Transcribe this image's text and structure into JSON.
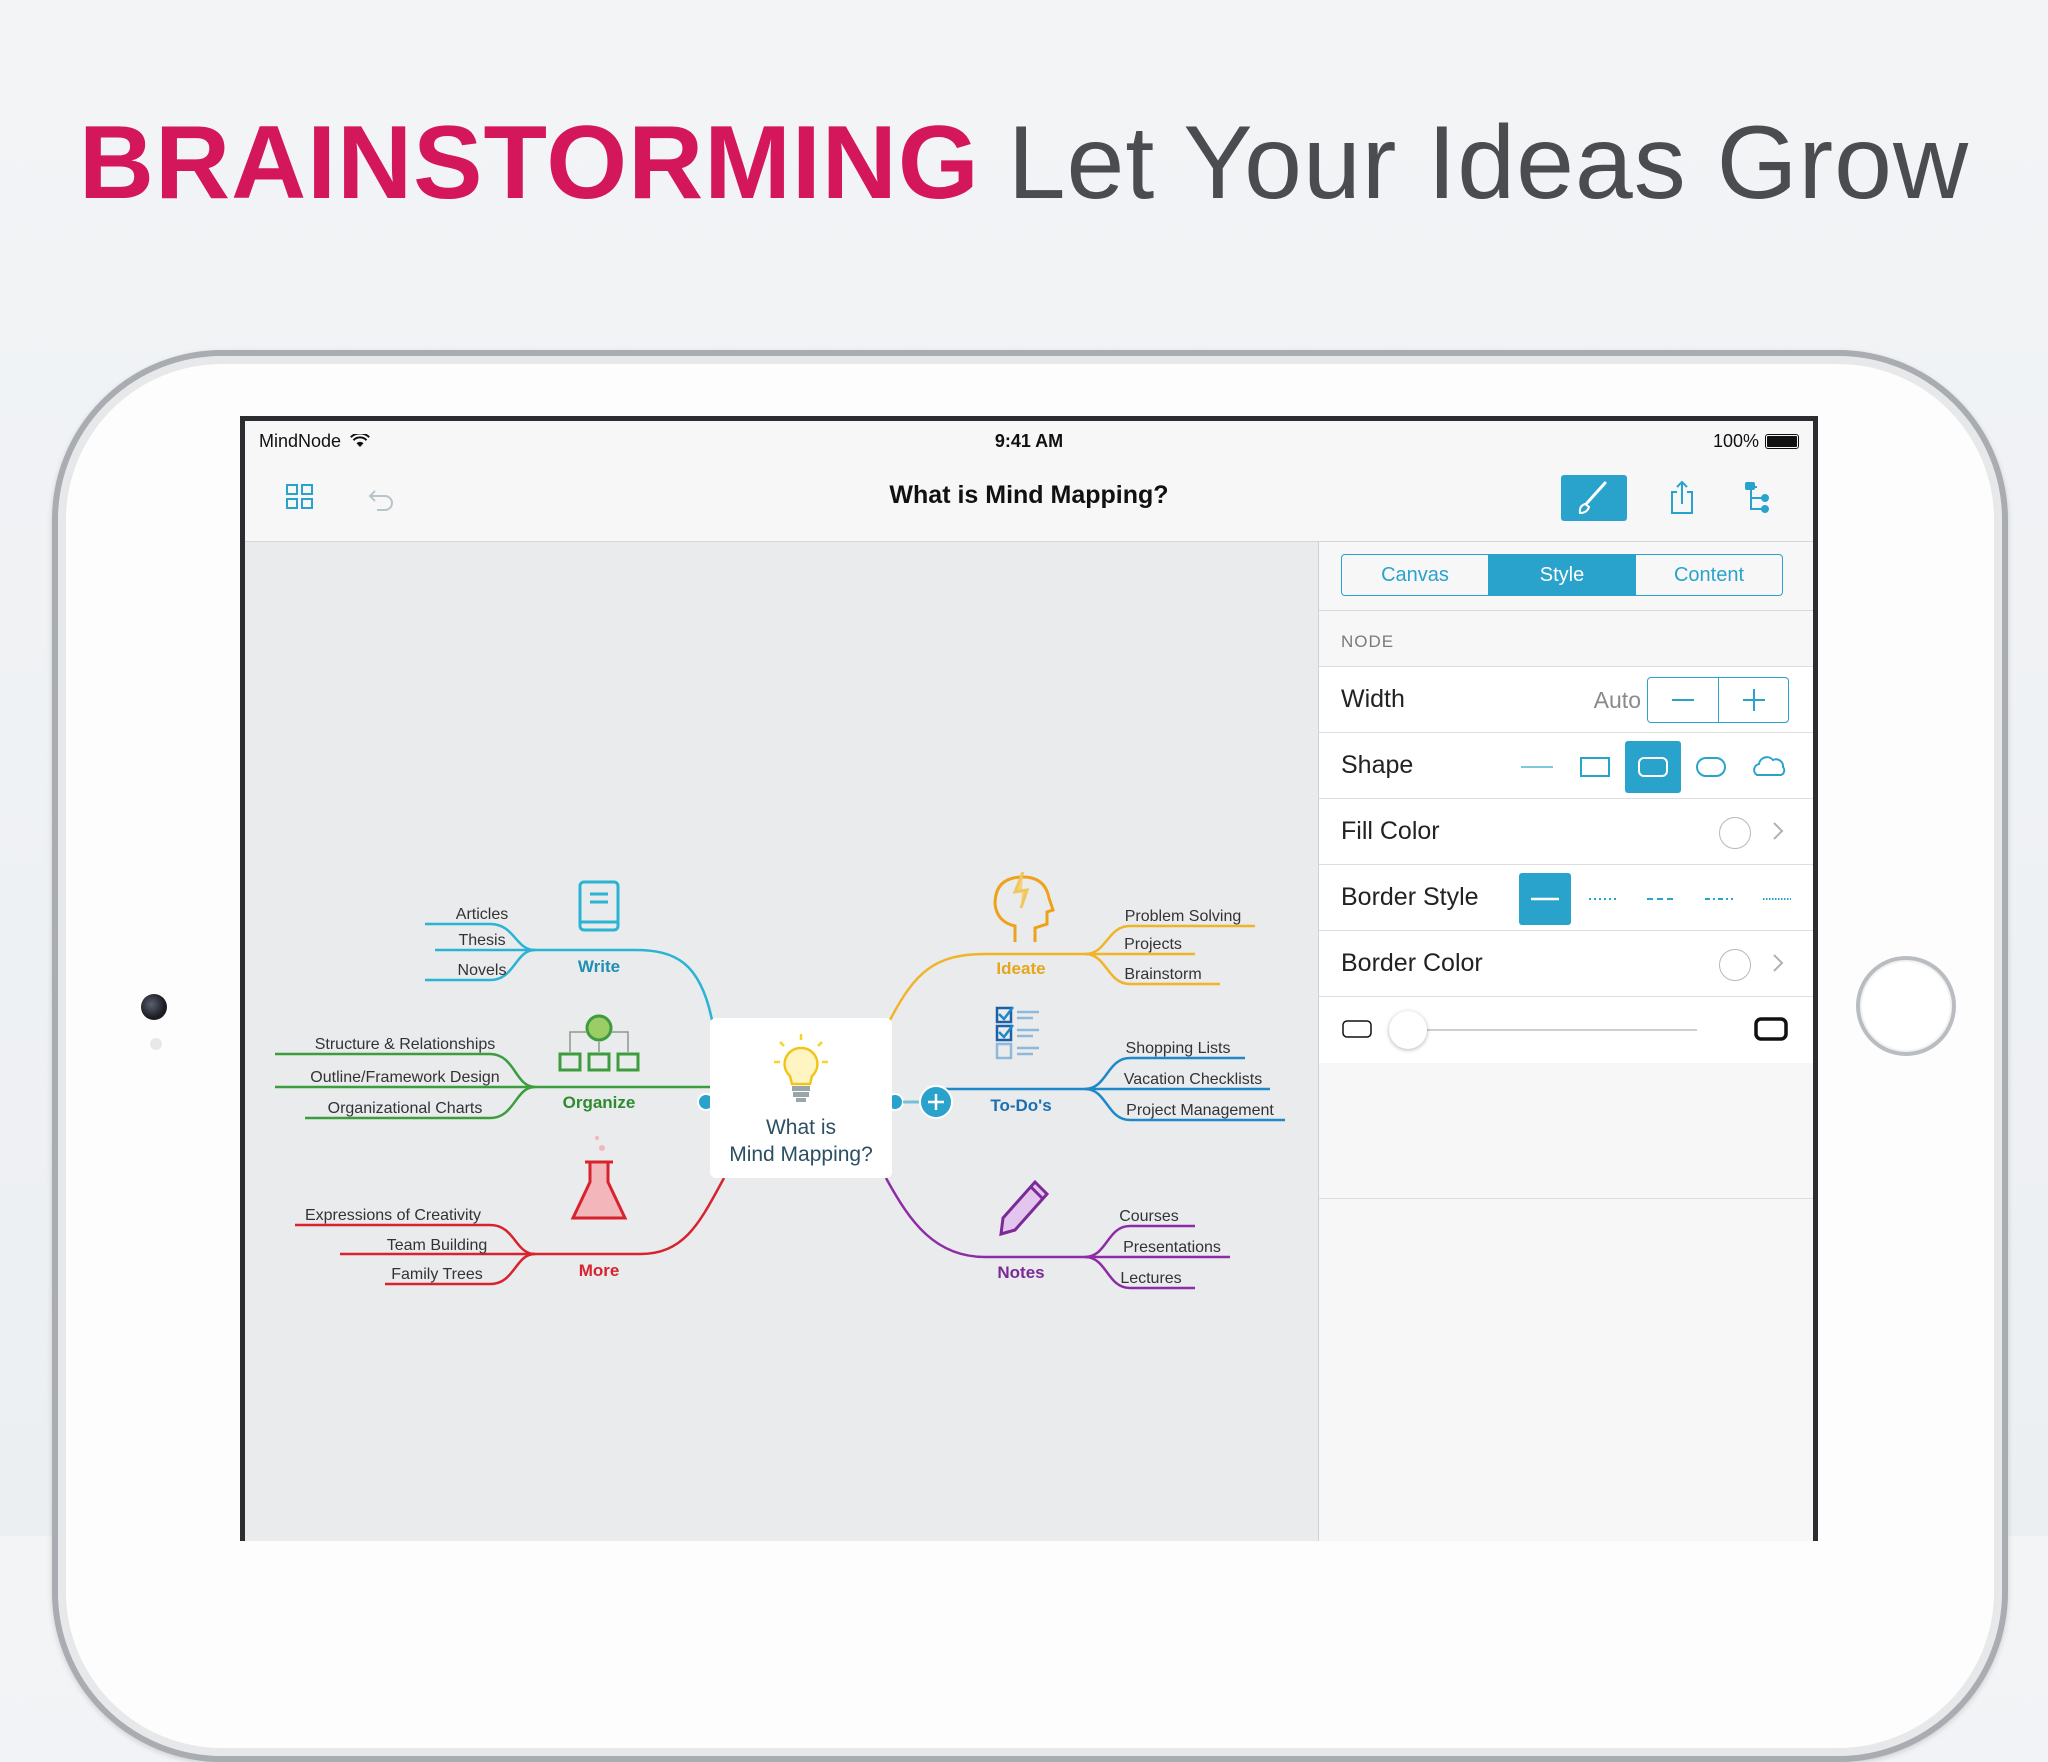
{
  "headline": {
    "accent": "BRAINSTORMING",
    "rest": "Let Your Ideas Grow"
  },
  "status_bar": {
    "app": "MindNode",
    "time": "9:41 AM",
    "battery": "100%"
  },
  "nav": {
    "title": "What is Mind Mapping?"
  },
  "inspector": {
    "tabs": [
      "Canvas",
      "Style",
      "Content"
    ],
    "section": "NODE",
    "width_label": "Width",
    "width_value": "Auto",
    "shape_label": "Shape",
    "fill_label": "Fill Color",
    "border_style_label": "Border Style",
    "border_color_label": "Border Color"
  },
  "mindmap": {
    "central": [
      "What is",
      "Mind Mapping?"
    ],
    "branches": {
      "write": {
        "label": "Write",
        "color": "#2bb3d4",
        "items": [
          "Articles",
          "Thesis",
          "Novels"
        ]
      },
      "organize": {
        "label": "Organize",
        "color": "#3d9c3d",
        "items": [
          "Structure & Relationships",
          "Outline/Framework Design",
          "Organizational Charts"
        ]
      },
      "more": {
        "label": "More",
        "color": "#d8232f",
        "items": [
          "Expressions of Creativity",
          "Team Building",
          "Family Trees"
        ]
      },
      "ideate": {
        "label": "Ideate",
        "color": "#f0b429",
        "items": [
          "Problem Solving",
          "Projects",
          "Brainstorm"
        ]
      },
      "todos": {
        "label": "To-Do's",
        "color": "#1e88c8",
        "items": [
          "Shopping Lists",
          "Vacation Checklists",
          "Project Management"
        ]
      },
      "notes": {
        "label": "Notes",
        "color": "#8e2ca6",
        "items": [
          "Courses",
          "Presentations",
          "Lectures"
        ]
      }
    }
  },
  "colors": {
    "accent": "#d4175a",
    "tint": "#2aa3cc"
  }
}
